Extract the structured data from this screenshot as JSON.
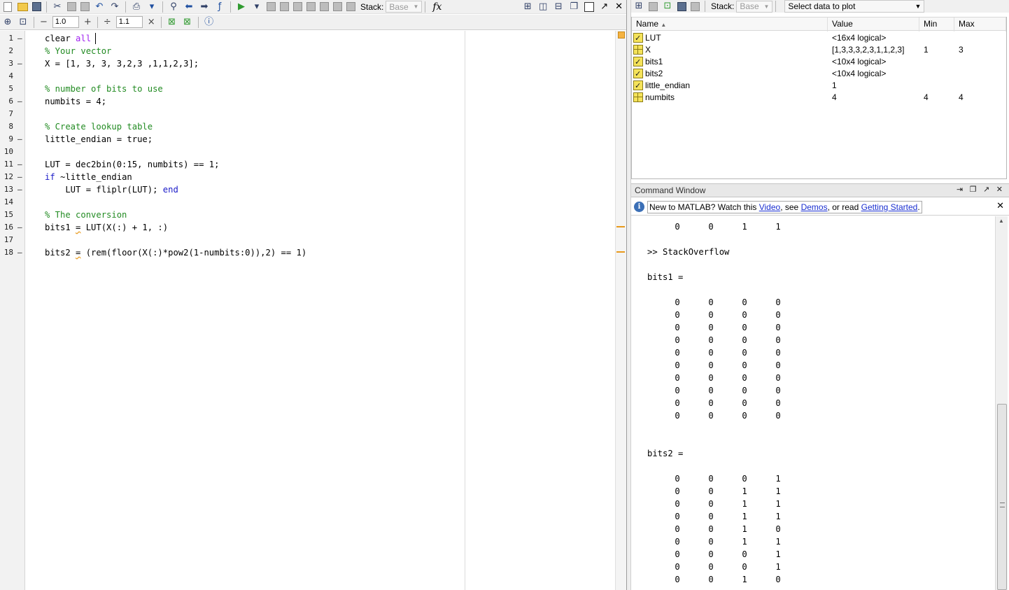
{
  "editor": {
    "toolbar": {
      "stack_label": "Stack:",
      "stack_value": "Base",
      "fx_label": "fx"
    },
    "cell_toolbar": {
      "minus": "−",
      "field1": "1.0",
      "plus": "+",
      "divide": "÷",
      "field2": "1.1",
      "times": "×"
    },
    "lines": [
      {
        "no": "1",
        "bp": "–",
        "parts": [
          {
            "t": "clear ",
            "c": ""
          },
          {
            "t": "all",
            "c": "str"
          }
        ]
      },
      {
        "no": "2",
        "bp": "",
        "parts": [
          {
            "t": "% Your vector",
            "c": "cm"
          }
        ]
      },
      {
        "no": "3",
        "bp": "–",
        "parts": [
          {
            "t": "X = [1, 3, 3, 3,2,3 ,1,1,2,3];",
            "c": ""
          }
        ]
      },
      {
        "no": "4",
        "bp": "",
        "parts": []
      },
      {
        "no": "5",
        "bp": "",
        "parts": [
          {
            "t": "% number of bits to use",
            "c": "cm"
          }
        ]
      },
      {
        "no": "6",
        "bp": "–",
        "parts": [
          {
            "t": "numbits = 4;",
            "c": ""
          }
        ]
      },
      {
        "no": "7",
        "bp": "",
        "parts": []
      },
      {
        "no": "8",
        "bp": "",
        "parts": [
          {
            "t": "% Create lookup table",
            "c": "cm"
          }
        ]
      },
      {
        "no": "9",
        "bp": "–",
        "parts": [
          {
            "t": "little_endian = true;",
            "c": ""
          }
        ]
      },
      {
        "no": "10",
        "bp": "",
        "parts": []
      },
      {
        "no": "11",
        "bp": "–",
        "parts": [
          {
            "t": "LUT = dec2bin(0:15, numbits) == 1;",
            "c": ""
          }
        ]
      },
      {
        "no": "12",
        "bp": "–",
        "parts": [
          {
            "t": "if",
            "c": "kw"
          },
          {
            "t": " ~little_endian",
            "c": ""
          }
        ]
      },
      {
        "no": "13",
        "bp": "–",
        "parts": [
          {
            "t": "    LUT = fliplr(LUT); ",
            "c": ""
          },
          {
            "t": "end",
            "c": "kw"
          }
        ]
      },
      {
        "no": "14",
        "bp": "",
        "parts": []
      },
      {
        "no": "15",
        "bp": "",
        "parts": [
          {
            "t": "% The conversion",
            "c": "cm"
          }
        ]
      },
      {
        "no": "16",
        "bp": "–",
        "parts": [
          {
            "t": "bits1 ",
            "c": ""
          },
          {
            "t": "=",
            "c": "warn"
          },
          {
            "t": " LUT(X(:) + 1, :)",
            "c": ""
          }
        ]
      },
      {
        "no": "17",
        "bp": "",
        "parts": []
      },
      {
        "no": "18",
        "bp": "–",
        "parts": [
          {
            "t": "bits2 ",
            "c": ""
          },
          {
            "t": "=",
            "c": "warn"
          },
          {
            "t": " (rem(floor(X(:)*pow2(1-numbits:0)),2) == 1)",
            "c": ""
          }
        ]
      }
    ]
  },
  "workspace": {
    "toolbar": {
      "stack_label": "Stack:",
      "stack_value": "Base",
      "plot_select": "Select data to plot"
    },
    "columns": {
      "name": "Name",
      "value": "Value",
      "min": "Min",
      "max": "Max"
    },
    "variables": [
      {
        "name": "LUT",
        "value": "<16x4 logical>",
        "min": "",
        "max": "",
        "icon": "logical-icon"
      },
      {
        "name": "X",
        "value": "[1,3,3,3,2,3,1,1,2,3]",
        "min": "1",
        "max": "3",
        "icon": "matrix-icon"
      },
      {
        "name": "bits1",
        "value": "<10x4 logical>",
        "min": "",
        "max": "",
        "icon": "logical-icon"
      },
      {
        "name": "bits2",
        "value": "<10x4 logical>",
        "min": "",
        "max": "",
        "icon": "logical-icon"
      },
      {
        "name": "little_endian",
        "value": "1",
        "min": "",
        "max": "",
        "icon": "logical-icon"
      },
      {
        "name": "numbits",
        "value": "4",
        "min": "4",
        "max": "4",
        "icon": "matrix-icon"
      }
    ]
  },
  "command_window": {
    "title": "Command Window",
    "title_controls": "⇥ ❐ ↗ ✕",
    "info": {
      "prefix": "New to MATLAB? Watch this ",
      "video": "Video",
      "sep1": ", see ",
      "demos": "Demos",
      "sep2": ", or read ",
      "getting_started": "Getting Started",
      "suffix": "."
    },
    "output": [
      {
        "type": "row",
        "values": [
          "0",
          "0",
          "1",
          "1"
        ]
      },
      {
        "type": "blank"
      },
      {
        "type": "text",
        "text": ">> StackOverflow"
      },
      {
        "type": "blank"
      },
      {
        "type": "text",
        "text": "bits1 ="
      },
      {
        "type": "blank"
      },
      {
        "type": "row",
        "values": [
          "0",
          "0",
          "0",
          "0"
        ]
      },
      {
        "type": "row",
        "values": [
          "0",
          "0",
          "0",
          "0"
        ]
      },
      {
        "type": "row",
        "values": [
          "0",
          "0",
          "0",
          "0"
        ]
      },
      {
        "type": "row",
        "values": [
          "0",
          "0",
          "0",
          "0"
        ]
      },
      {
        "type": "row",
        "values": [
          "0",
          "0",
          "0",
          "0"
        ]
      },
      {
        "type": "row",
        "values": [
          "0",
          "0",
          "0",
          "0"
        ]
      },
      {
        "type": "row",
        "values": [
          "0",
          "0",
          "0",
          "0"
        ]
      },
      {
        "type": "row",
        "values": [
          "0",
          "0",
          "0",
          "0"
        ]
      },
      {
        "type": "row",
        "values": [
          "0",
          "0",
          "0",
          "0"
        ]
      },
      {
        "type": "row",
        "values": [
          "0",
          "0",
          "0",
          "0"
        ]
      },
      {
        "type": "blank"
      },
      {
        "type": "blank"
      },
      {
        "type": "text",
        "text": "bits2 ="
      },
      {
        "type": "blank"
      },
      {
        "type": "row",
        "values": [
          "0",
          "0",
          "0",
          "1"
        ]
      },
      {
        "type": "row",
        "values": [
          "0",
          "0",
          "1",
          "1"
        ]
      },
      {
        "type": "row",
        "values": [
          "0",
          "0",
          "1",
          "1"
        ]
      },
      {
        "type": "row",
        "values": [
          "0",
          "0",
          "1",
          "1"
        ]
      },
      {
        "type": "row",
        "values": [
          "0",
          "0",
          "1",
          "0"
        ]
      },
      {
        "type": "row",
        "values": [
          "0",
          "0",
          "1",
          "1"
        ]
      },
      {
        "type": "row",
        "values": [
          "0",
          "0",
          "0",
          "1"
        ]
      },
      {
        "type": "row",
        "values": [
          "0",
          "0",
          "0",
          "1"
        ]
      },
      {
        "type": "row",
        "values": [
          "0",
          "0",
          "1",
          "0"
        ]
      }
    ]
  }
}
